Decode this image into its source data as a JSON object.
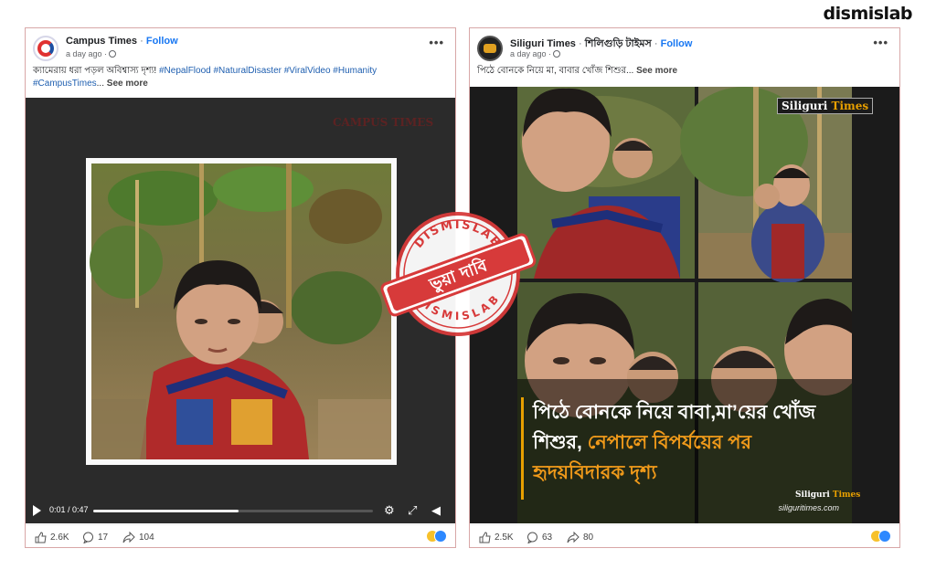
{
  "brand": "dismislab",
  "stamp": {
    "arc_top": "DISMISLAB",
    "arc_bottom": "DISMISLAB",
    "label": "ভুয়া দাবি"
  },
  "posts": [
    {
      "page_name": "Campus Times",
      "separator": " · ",
      "follow": "Follow",
      "time": "a day ago ·",
      "caption_text": "ক্যামেরায় ধরা পড়ল অবিশ্বাস্য দৃশ্য!",
      "hashtags": "#NepalFlood #NaturalDisaster #ViralVideo #Humanity #CampusTimes",
      "ellipsis": "...",
      "see_more": "See more",
      "more_icon": "•••",
      "video": {
        "watermark": "CAMPUS TIMES",
        "time_label": "0:01 / 0:47",
        "progress": 0.52,
        "icons": [
          "play-icon",
          "settings-icon",
          "fullscreen-icon",
          "volume-icon"
        ]
      },
      "likes": "2.6K",
      "comments": "17",
      "shares": "104"
    },
    {
      "page_name": "Siliguri Times",
      "separator": " · ",
      "page_name_bn": "শিলিগুড়ি টাইমস",
      "follow": "Follow",
      "time": "a day ago ·",
      "caption_text": "পিঠে বোনকে নিয়ে মা, বাবার খোঁজ শিশুর",
      "ellipsis": "...",
      "see_more": "See more",
      "more_icon": "•••",
      "image": {
        "tag_a": "Siliguri",
        "tag_b": "Times",
        "caption_line1": "পিঠে বোনকে নিয়ে বাবা,মা’য়ের খোঁজ",
        "caption_line2_w": "শিশুর, ",
        "caption_line2_o": "নেপালে বিপর্যয়ের পর",
        "caption_line3": "হৃদয়বিদারক দৃশ্য",
        "site": "siliguritimes.com"
      },
      "likes": "2.5K",
      "comments": "63",
      "shares": "80"
    }
  ]
}
